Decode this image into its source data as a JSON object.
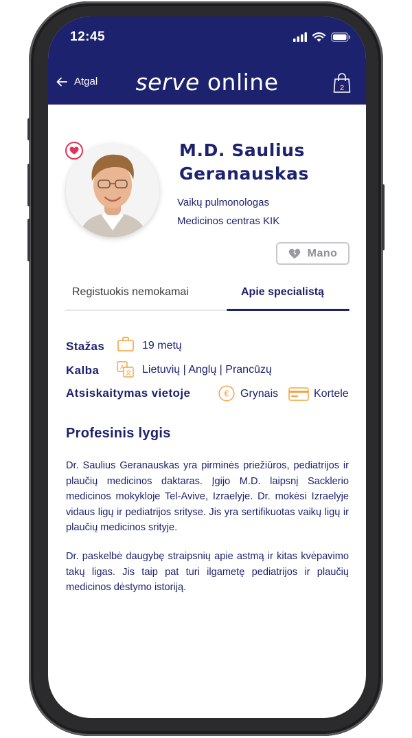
{
  "status_bar": {
    "time": "12:45"
  },
  "header": {
    "back_label": "Atgal",
    "logo_part1": "serve",
    "logo_part2": "online",
    "cart_count": "2"
  },
  "profile": {
    "name_line1": "M.D. Saulius",
    "name_line2": "Geranauskas",
    "specialty": "Vaikų pulmonologas",
    "clinic": "Medicinos centras KIK",
    "my_button_label": "Mano"
  },
  "tabs": [
    {
      "label": "Registuokis nemokamai",
      "active": false
    },
    {
      "label": "Apie specialistą",
      "active": true
    }
  ],
  "info": {
    "experience_label": "Stažas",
    "experience_value": "19 metų",
    "language_label": "Kalba",
    "language_value": "Lietuvių | Anglų | Prancūzų",
    "payment_label": "Atsiskaitymas vietoje",
    "payment_cash": "Grynais",
    "payment_card": "Kortele"
  },
  "about": {
    "title": "Profesinis lygis",
    "paragraph1": "Dr. Saulius Geranauskas yra pirminės priežiūros, pediatrijos ir plaučių medicinos daktaras. Įgijo M.D. laipsnį Sacklerio medicinos mokykloje Tel-Avive, Izraelyje. Dr. mokėsi Izraelyje vidaus ligų ir pediatrijos srityse. Jis yra sertifikuotas vaikų ligų ir plaučių medicinos srityje.",
    "paragraph2": "Dr. paskelbė daugybę straipsnių apie astmą ir kitas kvėpavimo takų ligas. Jis taip pat turi ilgametę pediatrijos ir plaučių medicinos dėstymo istoriją."
  },
  "colors": {
    "primary": "#1d226e",
    "accent": "#f4a33b",
    "favorite": "#e2315a"
  },
  "icons": [
    "signal-icon",
    "wifi-icon",
    "battery-icon",
    "arrow-left-icon",
    "shopping-bag-icon",
    "heart-icon",
    "broken-heart-icon",
    "briefcase-icon",
    "translate-icon",
    "euro-coin-icon",
    "credit-card-icon"
  ]
}
